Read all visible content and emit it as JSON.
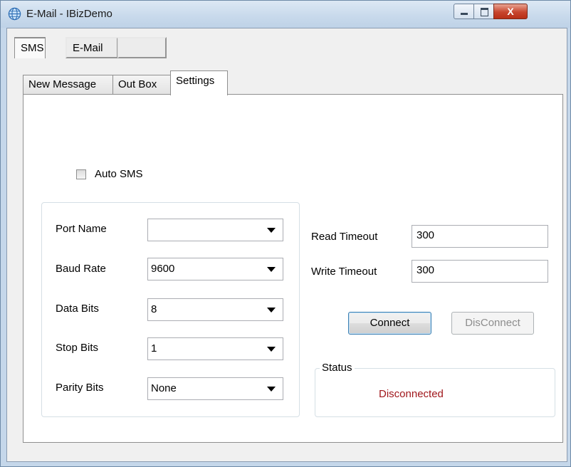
{
  "window": {
    "title": "E-Mail - IBizDemo",
    "app_icon": "globe-icon",
    "close_glyph": "X"
  },
  "outer_tabs": [
    {
      "label": "SMS",
      "selected": true
    },
    {
      "label": "E-Mail",
      "selected": false
    },
    {
      "label": "",
      "selected": false
    }
  ],
  "inner_tabs": [
    {
      "label": "New Message",
      "selected": false
    },
    {
      "label": "Out Box",
      "selected": false
    },
    {
      "label": "Settings",
      "selected": true
    }
  ],
  "settings": {
    "auto_sms": {
      "label": "Auto SMS",
      "checked": false
    },
    "port_name": {
      "label": "Port Name",
      "value": ""
    },
    "baud_rate": {
      "label": "Baud Rate",
      "value": "9600"
    },
    "data_bits": {
      "label": "Data Bits",
      "value": "8"
    },
    "stop_bits": {
      "label": "Stop Bits",
      "value": "1"
    },
    "parity_bits": {
      "label": "Parity Bits",
      "value": "None"
    },
    "read_timeout": {
      "label": "Read Timeout",
      "value": "300"
    },
    "write_timeout": {
      "label": "Write Timeout",
      "value": "300"
    },
    "connect_label": "Connect",
    "disconnect_label": "DisConnect",
    "status_legend": "Status",
    "status_value": "Disconnected"
  },
  "colors": {
    "status_text": "#a0161b",
    "close_button": "#c7452d"
  }
}
